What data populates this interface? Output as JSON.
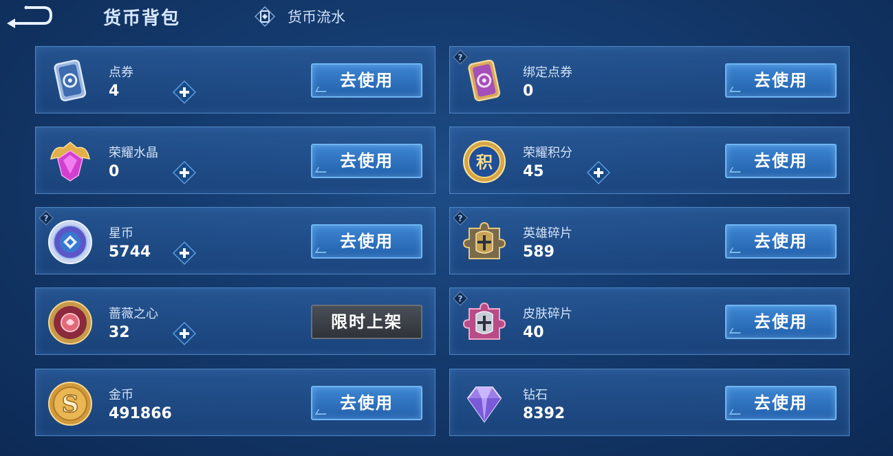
{
  "header": {
    "title": "货币背包",
    "flow_label": "货币流水"
  },
  "currencies": [
    {
      "name": "点券",
      "count": "4",
      "action": "去使用",
      "icon": "coupon-icon"
    },
    {
      "name": "绑定点券",
      "count": "0",
      "action": "去使用",
      "icon": "bound-coupon-icon"
    },
    {
      "name": "荣耀水晶",
      "count": "0",
      "action": "去使用",
      "icon": "glory-crystal-icon"
    },
    {
      "name": "荣耀积分",
      "count": "45",
      "action": "去使用",
      "icon": "glory-points-icon"
    },
    {
      "name": "星币",
      "count": "5744",
      "action": "去使用",
      "icon": "star-coin-icon"
    },
    {
      "name": "英雄碎片",
      "count": "589",
      "action": "去使用",
      "icon": "hero-fragment-icon"
    },
    {
      "name": "蔷薇之心",
      "count": "32",
      "action": "限时上架",
      "icon": "rose-heart-icon"
    },
    {
      "name": "皮肤碎片",
      "count": "40",
      "action": "去使用",
      "icon": "skin-fragment-icon"
    },
    {
      "name": "金币",
      "count": "491866",
      "action": "去使用",
      "icon": "gold-coin-icon"
    },
    {
      "name": "钻石",
      "count": "8392",
      "action": "去使用",
      "icon": "diamond-icon"
    }
  ]
}
